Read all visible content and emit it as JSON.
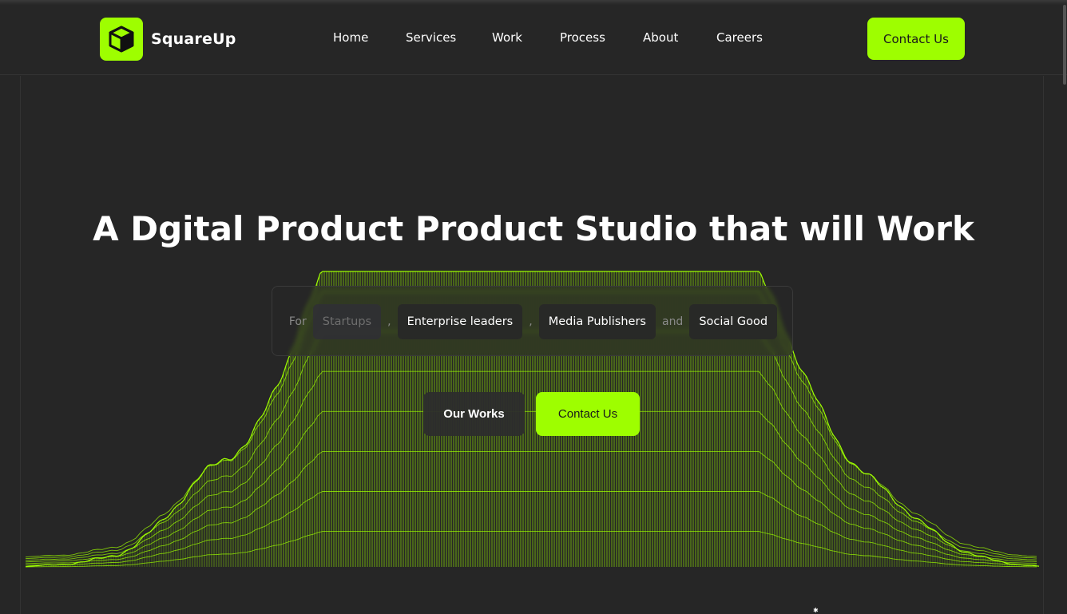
{
  "brand": {
    "name": "SquareUp",
    "accent": "#9efe00",
    "logo_icon": "cube-icon"
  },
  "nav": {
    "links": [
      "Home",
      "Services",
      "Work",
      "Process",
      "About",
      "Careers"
    ],
    "cta": "Contact Us"
  },
  "hero": {
    "title": "A Dgital Product Product Studio that will Work",
    "for_label": "For",
    "audiences": [
      "Startups",
      "Enterprise leaders",
      "Media Publishers",
      "Social Good"
    ],
    "separators": [
      ",",
      ",",
      "and"
    ],
    "primary_button": "Our Works",
    "secondary_button": "Contact Us"
  },
  "colors": {
    "background": "#262626",
    "accent": "#9efe00",
    "text": "#ffffff"
  }
}
